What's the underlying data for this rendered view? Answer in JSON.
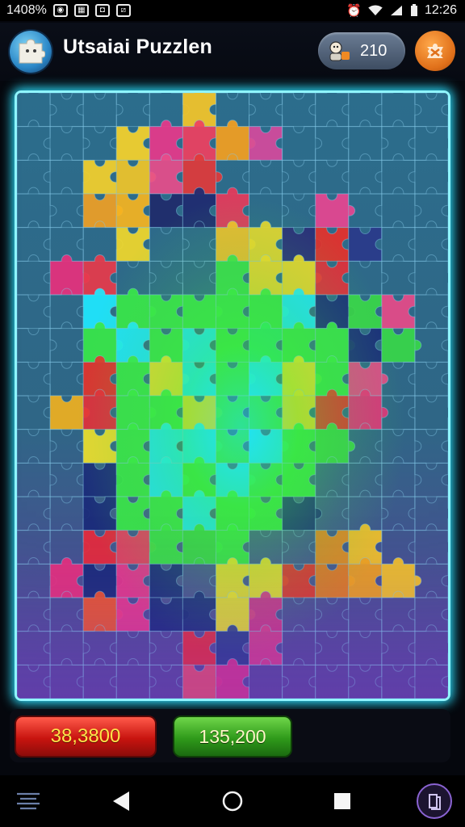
{
  "status_bar": {
    "left_text": "1408%",
    "time": "12:26",
    "icons": [
      "whatsapp-icon",
      "gallery-icon",
      "camera-icon",
      "slashed-box-icon"
    ],
    "right_icons": [
      "alarm-off-icon",
      "wifi-icon",
      "signal-icon",
      "battery-icon"
    ]
  },
  "header": {
    "title": "Utsaiai Puzzlen",
    "logo_icon": "puzzle-piece-logo-icon",
    "coins": "210",
    "coin_icon": "character-coin-icon",
    "settings_icon": "puzzle-piece-settings-icon"
  },
  "board": {
    "columns": 13,
    "rows": 18,
    "border_color": "#8ff5ff",
    "glow_color": "#2de0ff",
    "base_color": "#2f6a8c"
  },
  "scores": {
    "red_score": "38,3800",
    "green_score": "135,200"
  },
  "nav": {
    "items": [
      "menu-icon",
      "back-icon",
      "home-icon",
      "recent-apps-icon",
      "pieces-icon"
    ]
  },
  "colors": {
    "accent_red": "#c8140f",
    "accent_green": "#2f9a1a",
    "accent_orange": "#e0701a",
    "neon_cyan": "#2de0ff"
  }
}
